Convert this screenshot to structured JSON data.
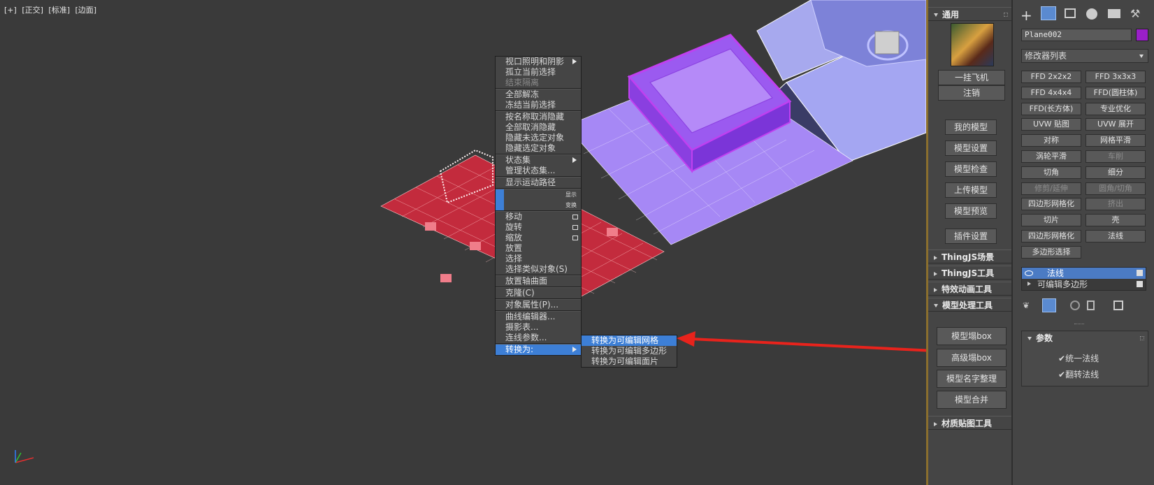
{
  "viewport": {
    "labels": [
      "[+]",
      "[正交]",
      "[标准]",
      "[边面]"
    ]
  },
  "context_menu": {
    "items": [
      {
        "label": "视口照明和阴影",
        "state": "normal",
        "submenu": true
      },
      {
        "label": "孤立当前选择",
        "state": "normal"
      },
      {
        "label": "结束隔离",
        "state": "disabled"
      },
      {
        "sep": true
      },
      {
        "label": "全部解冻",
        "state": "normal"
      },
      {
        "label": "冻结当前选择",
        "state": "normal"
      },
      {
        "sep": true
      },
      {
        "label": "按名称取消隐藏",
        "state": "normal"
      },
      {
        "label": "全部取消隐藏",
        "state": "normal"
      },
      {
        "label": "隐藏未选定对象",
        "state": "normal"
      },
      {
        "label": "隐藏选定对象",
        "state": "normal"
      },
      {
        "sep": true
      },
      {
        "label": "状态集",
        "state": "normal",
        "submenu": true
      },
      {
        "label": "管理状态集...",
        "state": "normal"
      },
      {
        "sep": true
      },
      {
        "label": "显示运动路径",
        "state": "normal"
      },
      {
        "sep": true
      },
      {
        "label": "显示",
        "state": "small-header"
      },
      {
        "label": "变换",
        "state": "small-header"
      },
      {
        "sep": true
      },
      {
        "label": "移动",
        "state": "normal",
        "box": true
      },
      {
        "label": "旋转",
        "state": "normal",
        "box": true
      },
      {
        "label": "缩放",
        "state": "normal",
        "box": true
      },
      {
        "label": "放置",
        "state": "normal"
      },
      {
        "label": "选择",
        "state": "normal"
      },
      {
        "label": "选择类似对象(S)",
        "state": "normal"
      },
      {
        "sep": true
      },
      {
        "label": "放置轴曲面",
        "state": "normal"
      },
      {
        "sep": true
      },
      {
        "label": "克隆(C)",
        "state": "normal"
      },
      {
        "sep": true
      },
      {
        "label": "对象属性(P)...",
        "state": "normal"
      },
      {
        "sep": true
      },
      {
        "label": "曲线编辑器...",
        "state": "normal"
      },
      {
        "label": "摄影表...",
        "state": "normal"
      },
      {
        "label": "连线参数...",
        "state": "normal"
      },
      {
        "sep": true
      },
      {
        "label": "转换为:",
        "state": "highlight",
        "submenu": true
      }
    ],
    "submenu": [
      {
        "label": "转换为可编辑网格",
        "state": "highlight"
      },
      {
        "label": "转换为可编辑多边形",
        "state": "normal"
      },
      {
        "label": "转换为可编辑面片",
        "state": "normal"
      }
    ]
  },
  "mid_panel": {
    "general_title": "通用",
    "btn_login": "一挂飞机",
    "btn_logout": "注销",
    "tool_buttons": [
      "我的模型",
      "模型设置",
      "模型检查",
      "上传模型",
      "模型预览",
      "插件设置"
    ],
    "collapsed_sections": [
      "ThingJS场景",
      "ThingJS工具",
      "特效动画工具"
    ],
    "model_section_title": "模型处理工具",
    "model_buttons": [
      "模型塌box",
      "高级塌box",
      "模型名字整理",
      "模型合并"
    ],
    "texture_section_title": "材质贴图工具"
  },
  "right_panel": {
    "object_name": "Plane002",
    "object_color": "#9a1fc8",
    "modifier_list": "修改器列表",
    "grid_buttons": [
      {
        "label": "FFD 2x2x2",
        "enabled": true
      },
      {
        "label": "FFD 3x3x3",
        "enabled": true
      },
      {
        "label": "FFD 4x4x4",
        "enabled": true
      },
      {
        "label": "FFD(圆柱体)",
        "enabled": true
      },
      {
        "label": "FFD(长方体)",
        "enabled": true
      },
      {
        "label": "专业优化",
        "enabled": true
      },
      {
        "label": "UVW 贴图",
        "enabled": true
      },
      {
        "label": "UVW 展开",
        "enabled": true
      },
      {
        "label": "对称",
        "enabled": true
      },
      {
        "label": "网格平滑",
        "enabled": true
      },
      {
        "label": "涡轮平滑",
        "enabled": true
      },
      {
        "label": "车削",
        "enabled": false
      },
      {
        "label": "切角",
        "enabled": true
      },
      {
        "label": "细分",
        "enabled": true
      },
      {
        "label": "修剪/延伸",
        "enabled": false
      },
      {
        "label": "圆角/切角",
        "enabled": false
      },
      {
        "label": "四边形网格化",
        "enabled": true
      },
      {
        "label": "挤出",
        "enabled": false
      },
      {
        "label": "切片",
        "enabled": true
      },
      {
        "label": "壳",
        "enabled": true
      },
      {
        "label": "四边形网格化",
        "enabled": true
      },
      {
        "label": "法线",
        "enabled": true
      },
      {
        "label": "多边形选择",
        "enabled": true
      }
    ],
    "stack": [
      "法线",
      "可编辑多边形"
    ],
    "params_title": "参数",
    "checkbox_unify": "统一法线",
    "checkbox_flip": "翻转法线"
  },
  "colors": {
    "accent_blue": "#3d7fd6",
    "arrow_red": "#e8231c",
    "plane_red": "#c22a3b",
    "plane_purple": "#9b7dfa"
  }
}
